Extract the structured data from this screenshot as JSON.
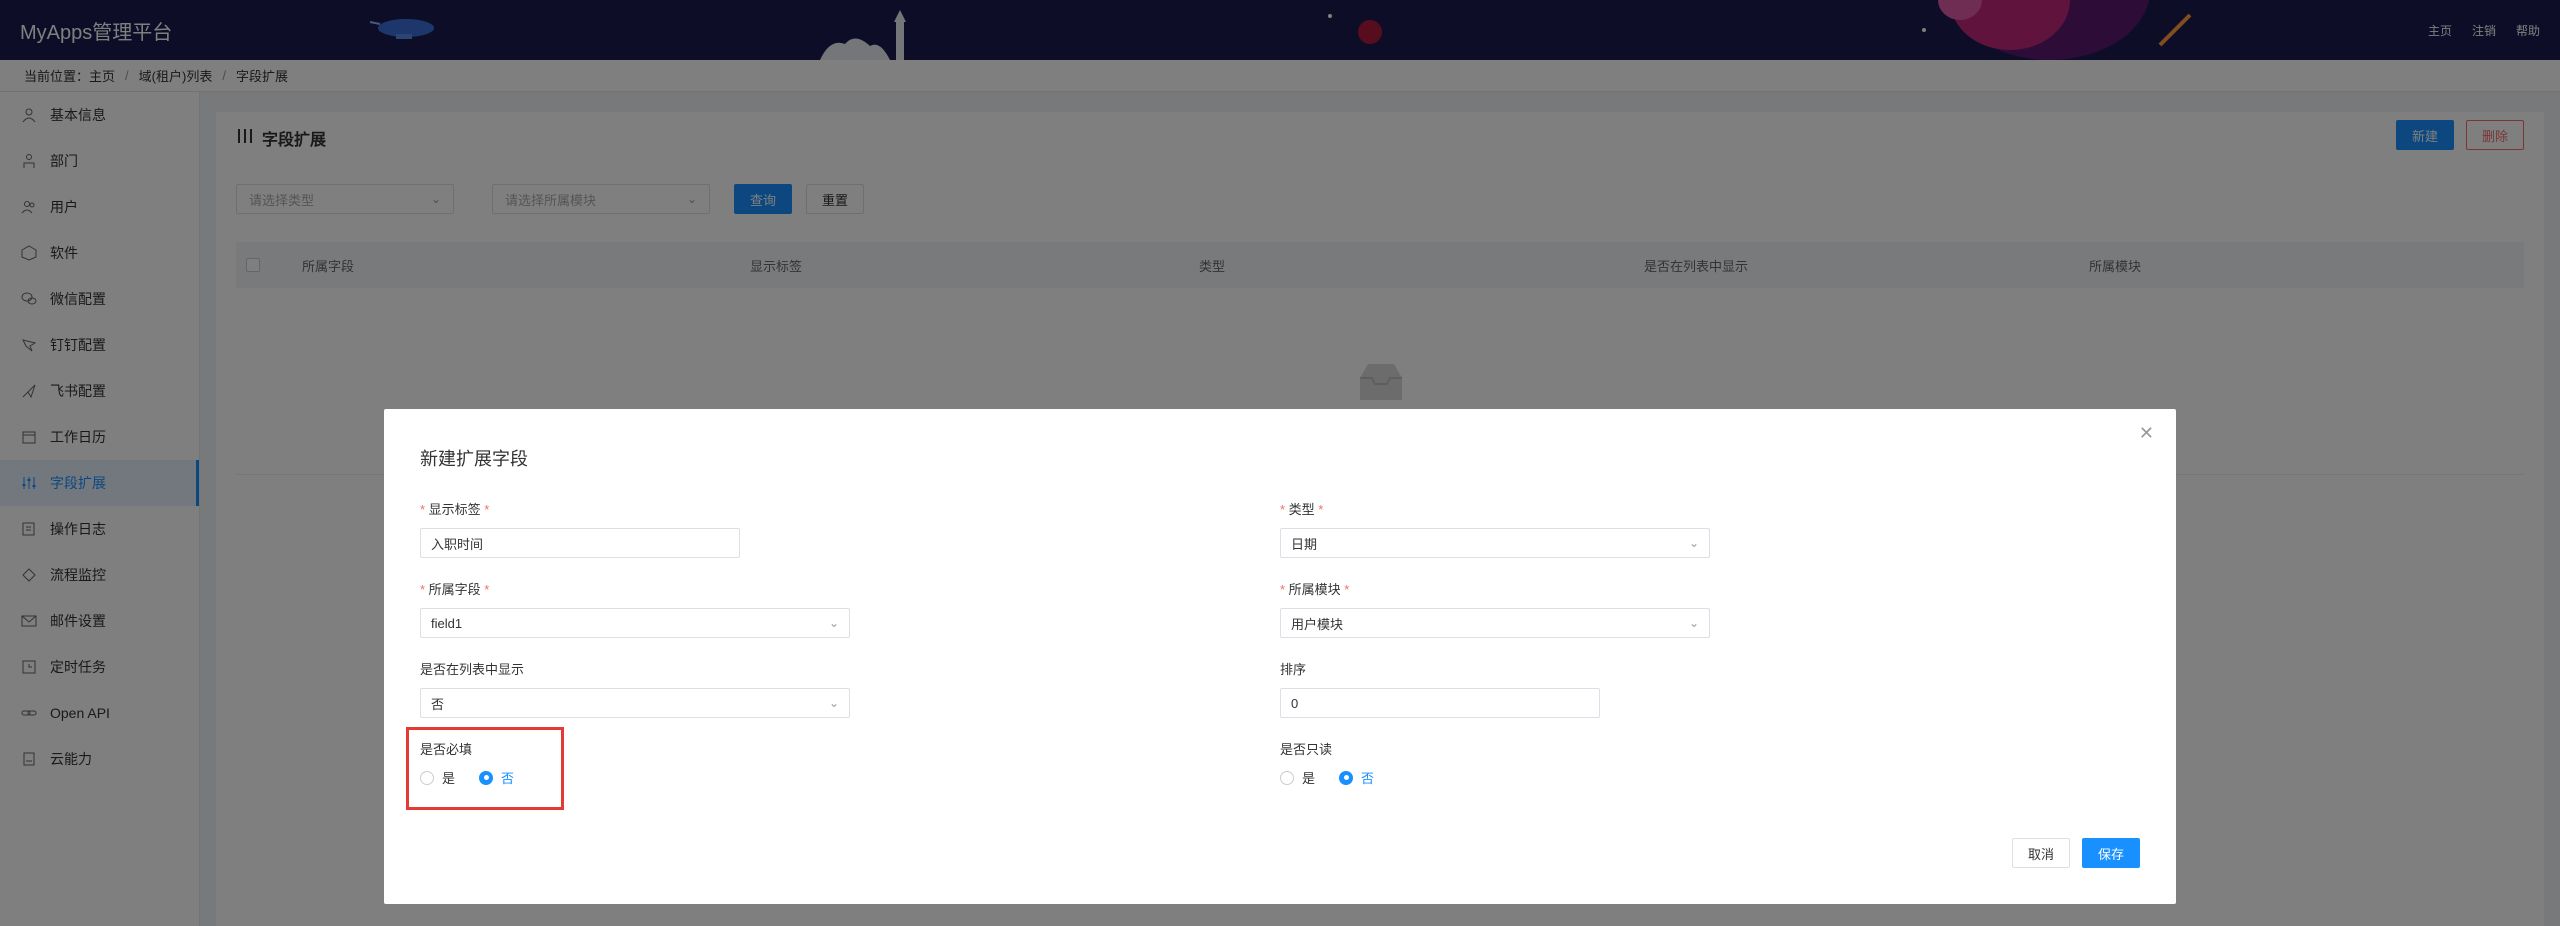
{
  "header": {
    "brand": "MyApps管理平台",
    "links": [
      "主页",
      "注销",
      "帮助"
    ]
  },
  "breadcrumb": {
    "prefix": "当前位置：",
    "items": [
      "主页",
      "域(租户)列表",
      "字段扩展"
    ]
  },
  "sidebar": {
    "items": [
      {
        "label": "基本信息",
        "icon": "user-icon"
      },
      {
        "label": "部门",
        "icon": "org-icon"
      },
      {
        "label": "用户",
        "icon": "users-icon"
      },
      {
        "label": "软件",
        "icon": "box-icon"
      },
      {
        "label": "微信配置",
        "icon": "wechat-icon"
      },
      {
        "label": "钉钉配置",
        "icon": "dingtalk-icon"
      },
      {
        "label": "飞书配置",
        "icon": "feishu-icon"
      },
      {
        "label": "工作日历",
        "icon": "calendar-icon"
      },
      {
        "label": "字段扩展",
        "icon": "sliders-icon",
        "active": true
      },
      {
        "label": "操作日志",
        "icon": "log-icon"
      },
      {
        "label": "流程监控",
        "icon": "diamond-icon"
      },
      {
        "label": "邮件设置",
        "icon": "mail-icon"
      },
      {
        "label": "定时任务",
        "icon": "clock-icon"
      },
      {
        "label": "Open API",
        "icon": "link-icon"
      },
      {
        "label": "云能力",
        "icon": "cloud-icon"
      }
    ]
  },
  "main": {
    "title": "字段扩展",
    "new_label": "新建",
    "delete_label": "删除",
    "filter_type_placeholder": "请选择类型",
    "filter_module_placeholder": "请选择所属模块",
    "query_label": "查询",
    "reset_label": "重置",
    "columns": [
      "所属字段",
      "显示标签",
      "类型",
      "是否在列表中显示",
      "所属模块"
    ]
  },
  "dialog": {
    "title": "新建扩展字段",
    "display_label": {
      "label": "显示标签",
      "value": "入职时间"
    },
    "type": {
      "label": "类型",
      "value": "日期"
    },
    "owner_field": {
      "label": "所属字段",
      "value": "field1"
    },
    "module": {
      "label": "所属模块",
      "value": "用户模块"
    },
    "show_in_list": {
      "label": "是否在列表中显示",
      "value": "否"
    },
    "sort": {
      "label": "排序",
      "value": "0"
    },
    "required": {
      "label": "是否必填",
      "yes": "是",
      "no": "否",
      "selected": "否"
    },
    "readonly": {
      "label": "是否只读",
      "yes": "是",
      "no": "否",
      "selected": "否"
    },
    "cancel_label": "取消",
    "save_label": "保存"
  },
  "colors": {
    "header_bg": "#1b1b4f",
    "primary": "#1890ff",
    "danger": "#f56c6c",
    "highlight": "#e53935"
  }
}
